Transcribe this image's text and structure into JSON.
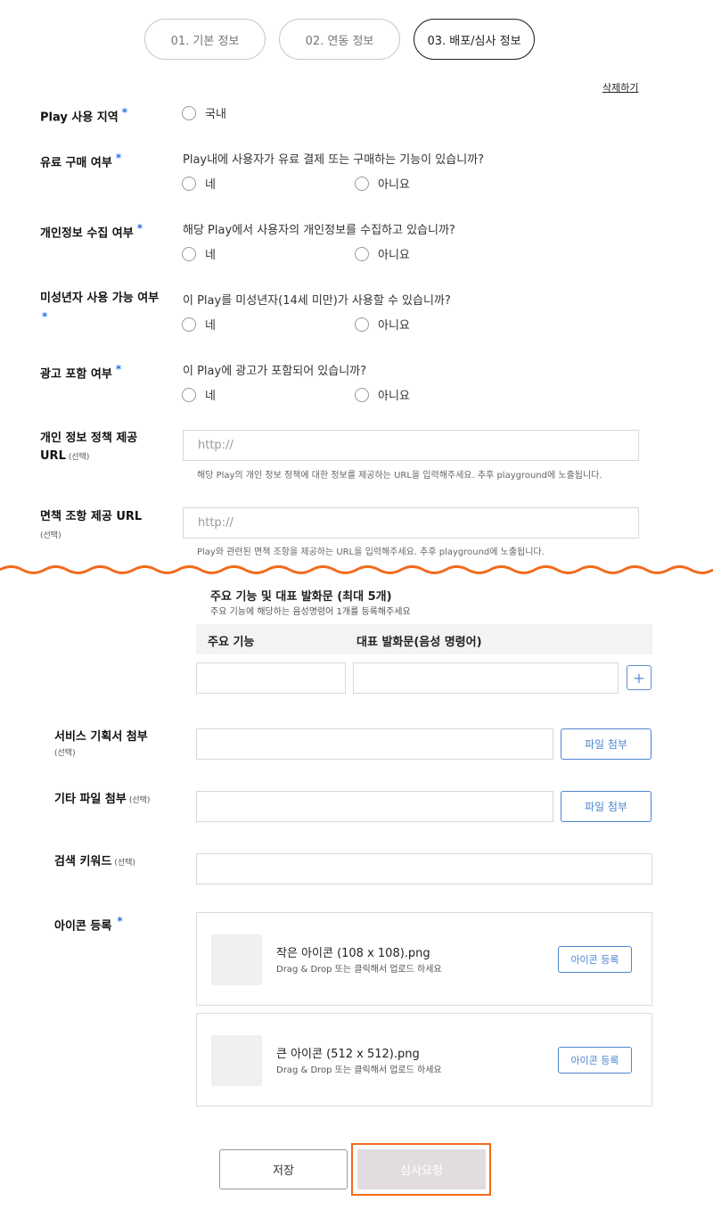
{
  "steps": [
    {
      "label": "01. 기본 정보"
    },
    {
      "label": "02. 연동 정보"
    },
    {
      "label": "03. 배포/심사 정보"
    }
  ],
  "delete_label": "삭제하기",
  "required_mark": "*",
  "optional_mark": "(선택)",
  "region": {
    "label": "Play 사용 지역",
    "option": "국내"
  },
  "paid": {
    "label": "유료 구매 여부",
    "question": "Play내에 사용자가 유료 결제 또는 구매하는 기능이 있습니까?",
    "yes": "네",
    "no": "아니요"
  },
  "privacy": {
    "label": "개인정보 수집 여부",
    "question": "해당 Play에서 사용자의 개인정보를 수집하고 있습니까?",
    "yes": "네",
    "no": "아니요"
  },
  "minor": {
    "label": "미성년자 사용 가능 여부",
    "question": "이 Play를 미성년자(14세 미만)가 사용할 수 있습니까?",
    "yes": "네",
    "no": "아니요"
  },
  "ads": {
    "label": "광고 포함 여부",
    "question": "이 Play에 광고가 포함되어 있습니까?",
    "yes": "네",
    "no": "아니요"
  },
  "privacy_url": {
    "label_line1": "개인 정보 정책 제공",
    "label_line2": "URL",
    "placeholder": "http://",
    "help": "해당 Play의 개인 정보 정책에 대한 정보를 제공하는 URL을 입력해주세요. 추후 playground에 노출됩니다."
  },
  "disclaimer_url": {
    "label": "면책 조항 제공 URL",
    "placeholder": "http://",
    "help": "Play와 관련된 면책 조항을 제공하는 URL을 입력해주세요. 추후 playground에 노출됩니다."
  },
  "features": {
    "title": "주요 기능 및 대표 발화문 (최대 5개)",
    "subtitle": "주요 기능에 해당하는 음성명령어 1개를 등록해주세요",
    "col_feature": "주요 기능",
    "col_utterance": "대표 발화문(음성 명령어)",
    "add": "+"
  },
  "service_plan": {
    "label": "서비스 기획서 첨부",
    "button": "파일 첨부"
  },
  "other_file": {
    "label": "기타 파일 첨부",
    "button": "파일 첨부"
  },
  "keyword": {
    "label": "검색 키워드"
  },
  "icons": {
    "label": "아이콘 등록",
    "small": {
      "name": "작은 아이콘 (108 x 108).png",
      "hint": "Drag & Drop 또는 클릭해서 업로드 하세요",
      "button": "아이콘 등록"
    },
    "large": {
      "name": "큰 아이콘 (512 x 512).png",
      "hint": "Drag & Drop 또는 클릭해서 업로드 하세요",
      "button": "아이콘 등록"
    }
  },
  "actions": {
    "save": "저장",
    "submit": "심사요청"
  },
  "colors": {
    "accent": "#4d85cf",
    "required": "#1f6fe5",
    "highlight": "#f26a1b",
    "wave": "#f26a1b"
  }
}
